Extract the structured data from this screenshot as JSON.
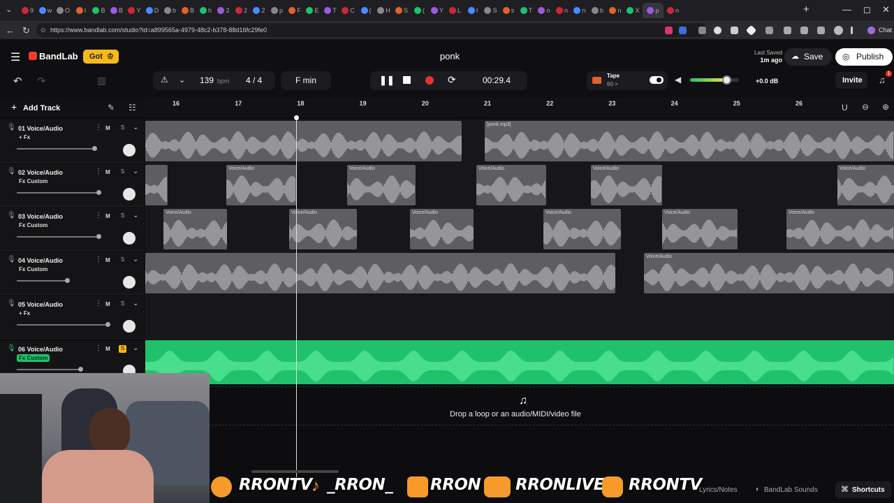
{
  "browser": {
    "url": "https://www.bandlab.com/studio?id=a899565a-4979-48c2-b378-88d16fc29fe0",
    "tab_titles": [
      "9",
      "w",
      "O",
      "I",
      "B",
      "B",
      "Y",
      "D",
      "b",
      "B",
      "h",
      "2",
      "2",
      "2",
      "p",
      "F",
      "E",
      "T",
      "C",
      "(",
      "H",
      "S",
      "(",
      "Y",
      "L",
      "I",
      "S",
      "s",
      "T",
      "n",
      "n",
      "n",
      "b",
      "n",
      "X",
      "p",
      "n"
    ],
    "chat_label": "Chat"
  },
  "header": {
    "logo": "BandLab",
    "got_button": "Got",
    "project_title": "ponk",
    "last_saved_label": "Last Saved",
    "last_saved_time": "1m ago",
    "save_button": "Save",
    "publish_button": "Publish"
  },
  "transport": {
    "tempo": "139",
    "tempo_unit": "bpm",
    "time_signature": "4 / 4",
    "key": "F min",
    "time": "00:29.4",
    "tape_label": "Tape",
    "tape_value": "60 >",
    "master_volume": "+0.0 dB",
    "invite_button": "Invite",
    "notification_count": "1",
    "volume_level": 0.75
  },
  "toolbar": {
    "add_track": "Add Track"
  },
  "ruler": {
    "bars": [
      "16",
      "17",
      "18",
      "19",
      "20",
      "21",
      "22",
      "23",
      "24",
      "25",
      "26"
    ]
  },
  "tracks": [
    {
      "name": "01  Voice/Audio",
      "fx": "+ Fx",
      "mute": "M",
      "solo": "S",
      "volume": 0.85,
      "active": false
    },
    {
      "name": "02  Voice/Audio",
      "fx": "Fx Custom",
      "mute": "M",
      "solo": "S",
      "volume": 0.9,
      "active": false
    },
    {
      "name": "03  Voice/Audio",
      "fx": "Fx Custom",
      "mute": "M",
      "solo": "S",
      "volume": 0.9,
      "active": false
    },
    {
      "name": "04  Voice/Audio",
      "fx": "Fx Custom",
      "mute": "M",
      "solo": "S",
      "volume": 0.55,
      "active": false
    },
    {
      "name": "05  Voice/Audio",
      "fx": "+ Fx",
      "mute": "M",
      "solo": "S",
      "volume": 1.0,
      "active": false
    },
    {
      "name": "06  Voice/Audio",
      "fx": "Fx Custom",
      "mute": "M",
      "solo": "S",
      "volume": 0.7,
      "active": true
    }
  ],
  "clips": {
    "track1": [
      "[ponk.mp3]"
    ],
    "clip_label": "Voice/Audio"
  },
  "drop_zone": {
    "text": "Drop a loop or an audio/MIDI/video file"
  },
  "footer": {
    "lyrics": "Lyrics/Notes",
    "sounds": "BandLab Sounds",
    "shortcuts": "Shortcuts"
  },
  "stream_overlay": {
    "twitter": "RRONTV",
    "tiktok": "_RRON_",
    "kick": "RRON",
    "youtube": "RRONLIVE",
    "instagram": "RRONTV"
  },
  "colors": {
    "accent_green": "#1fc26a",
    "record_red": "#e8322c",
    "got_yellow": "#f6b91a"
  }
}
